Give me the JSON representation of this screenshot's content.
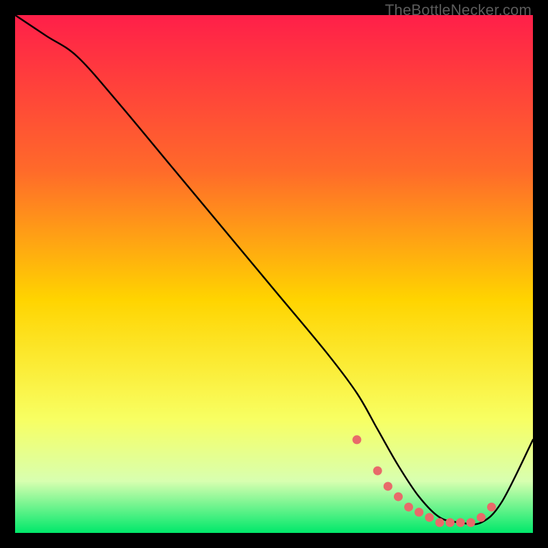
{
  "watermark": "TheBottleNecker.com",
  "colors": {
    "grad_top": "#ff1f49",
    "grad_mid1": "#ff6a2a",
    "grad_mid2": "#ffd400",
    "grad_low1": "#f8ff62",
    "grad_low2": "#d8ffb0",
    "grad_bottom": "#00e86a",
    "curve": "#000000",
    "dots": "#e86a6a"
  },
  "chart_data": {
    "type": "line",
    "title": "",
    "xlabel": "",
    "ylabel": "",
    "xlim": [
      0,
      100
    ],
    "ylim": [
      0,
      100
    ],
    "series": [
      {
        "name": "bottleneck-curve",
        "x": [
          0,
          6,
          12,
          20,
          30,
          40,
          50,
          60,
          66,
          70,
          74,
          78,
          82,
          86,
          90,
          94,
          100
        ],
        "y": [
          100,
          96,
          92,
          83,
          71,
          59,
          47,
          35,
          27,
          20,
          13,
          7,
          3,
          2,
          2,
          6,
          18
        ]
      }
    ],
    "markers": {
      "name": "highlight-dots",
      "x": [
        66,
        70,
        72,
        74,
        76,
        78,
        80,
        82,
        84,
        86,
        88,
        90,
        92
      ],
      "y": [
        18,
        12,
        9,
        7,
        5,
        4,
        3,
        2,
        2,
        2,
        2,
        3,
        5
      ]
    }
  }
}
